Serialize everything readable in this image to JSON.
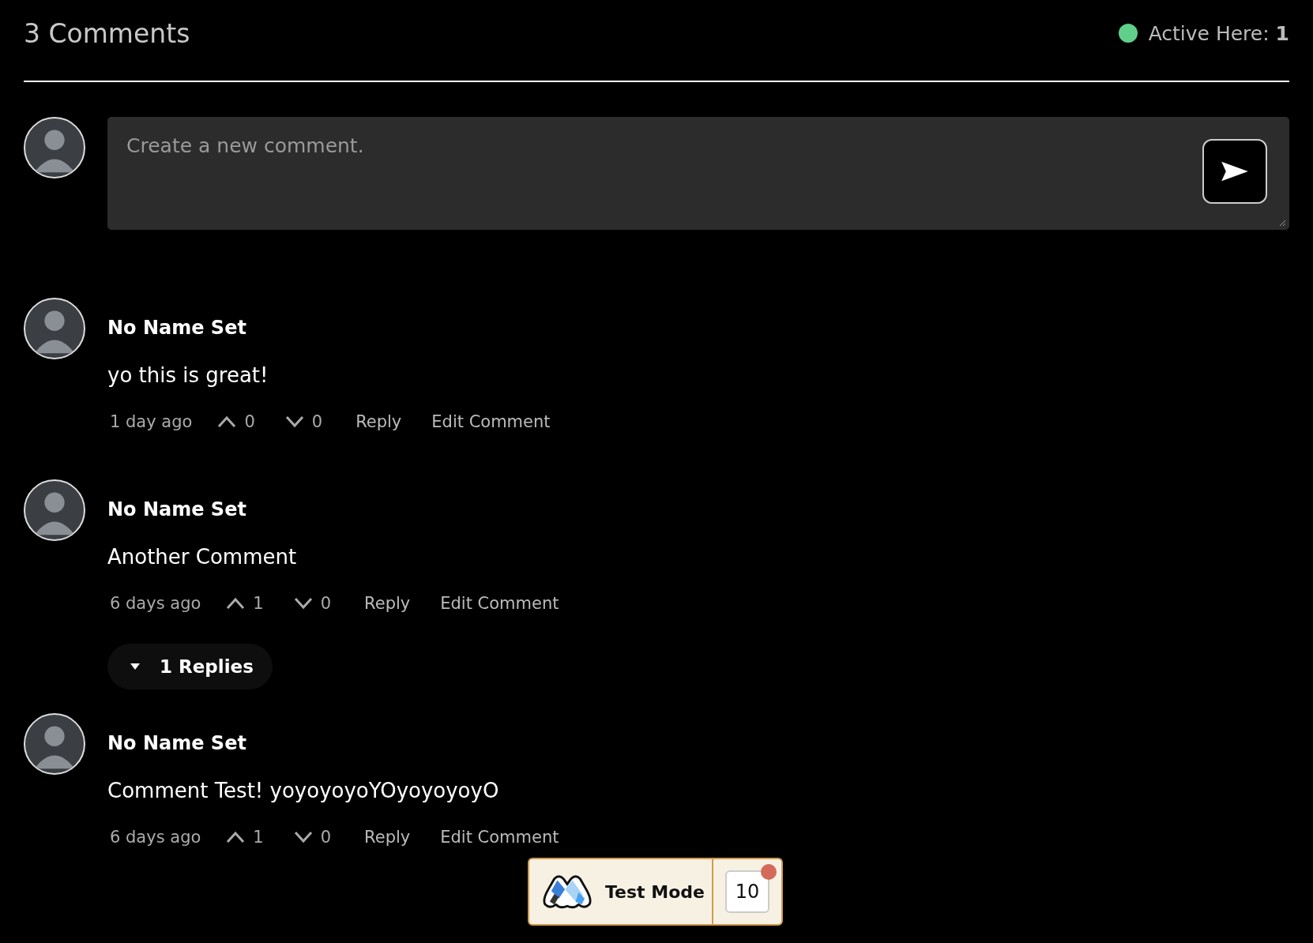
{
  "header": {
    "title": "3 Comments",
    "active_label": "Active Here: **1**"
  },
  "composer": {
    "placeholder": "Create a new comment."
  },
  "comments": [
    {
      "author": "No Name Set",
      "body": "yo this is great!",
      "time": "1 day ago",
      "upvotes": "0",
      "downvotes": "0",
      "reply": "Reply",
      "edit": "Edit Comment"
    },
    {
      "author": "No Name Set",
      "body": "Another Comment",
      "time": "6 days ago",
      "upvotes": "1",
      "downvotes": "0",
      "reply": "Reply",
      "edit": "Edit Comment",
      "replies": {
        "label": "1 Replies",
        "expanded": true
      }
    },
    {
      "author": "No Name Set",
      "body": "Comment Test! yoyoyoyoYOyoyoyoyO",
      "time": "6 days ago",
      "upvotes": "1",
      "downvotes": "0",
      "reply": "Reply",
      "edit": "Edit Comment"
    }
  ],
  "test_mode": {
    "label": "Test Mode",
    "count": "10"
  }
}
